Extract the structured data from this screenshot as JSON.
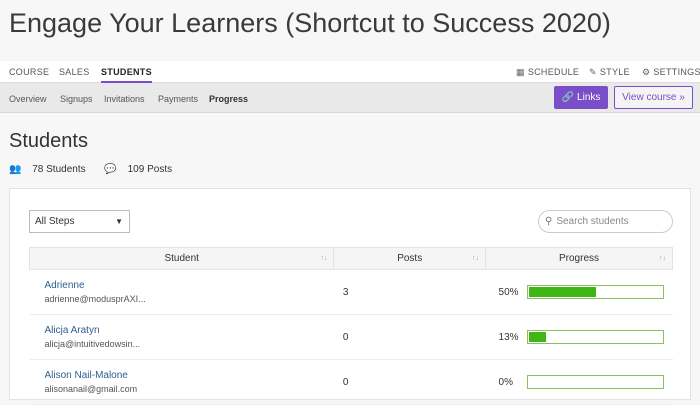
{
  "course_title": "Engage Your Learners (Shortcut to Success 2020)",
  "topnav": {
    "tabs": [
      "COURSE",
      "SALES",
      "STUDENTS"
    ],
    "active": "STUDENTS",
    "right": [
      {
        "icon": "calendar-icon",
        "label": "SCHEDULE"
      },
      {
        "icon": "brush-icon",
        "label": "STYLE"
      },
      {
        "icon": "gears-icon",
        "label": "SETTINGS"
      }
    ]
  },
  "subnav": {
    "items": [
      "Overview",
      "Signups",
      "Invitations",
      "Payments",
      "Progress"
    ],
    "active": "Progress",
    "links_button": "Links",
    "view_button": "View course »"
  },
  "page_title": "Students",
  "stats": {
    "students": "78 Students",
    "posts": "109 Posts"
  },
  "filter": {
    "selected": "All Steps"
  },
  "search": {
    "placeholder": "Search students"
  },
  "table": {
    "headers": [
      "Student",
      "Posts",
      "Progress"
    ],
    "rows": [
      {
        "name": "Adrienne",
        "email": "adrienne@modusprAXI...",
        "posts": "3",
        "progress_label": "50%",
        "progress": 0.5
      },
      {
        "name": "Alicja Aratyn",
        "email": "alicja@intuitivedowsin...",
        "posts": "0",
        "progress_label": "13%",
        "progress": 0.13
      },
      {
        "name": "Alison Nail-Malone",
        "email": "alisonanail@gmail.com",
        "posts": "0",
        "progress_label": "0%",
        "progress": 0
      }
    ]
  },
  "colors": {
    "accent": "#7a4ec8",
    "progress_fill": "#3fb517",
    "link": "#2f5e8e"
  }
}
